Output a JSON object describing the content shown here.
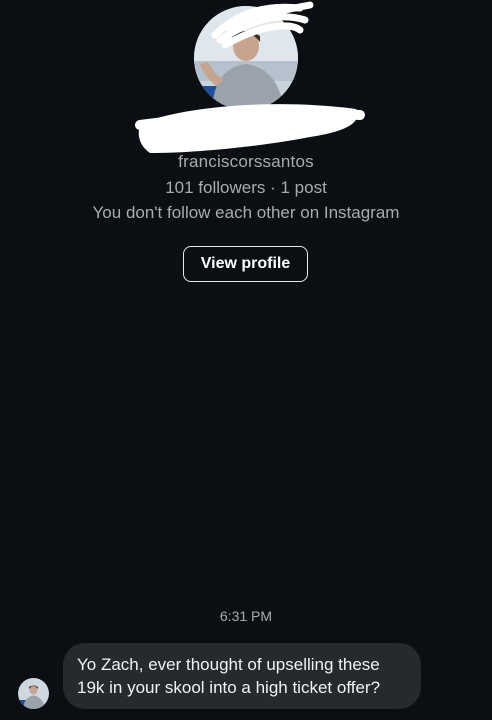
{
  "profile": {
    "username": "franciscorssantos",
    "stats": "101 followers · 1 post",
    "relation": "You don't follow each other on Instagram",
    "view_profile_label": "View profile"
  },
  "thread": {
    "timestamp": "6:31 PM",
    "messages": [
      {
        "text_line_1": "Yo Zach, ever thought of upselling these",
        "text_line_2": "19k in your skool into a high ticket offer?"
      }
    ]
  },
  "colors": {
    "background": "#0b0e13",
    "bubble": "#26292e",
    "secondary_text": "#a8abb0",
    "redaction": "#ffffff"
  },
  "icons": {
    "profile_avatar": "profile-photo",
    "sender_avatar": "profile-photo"
  }
}
